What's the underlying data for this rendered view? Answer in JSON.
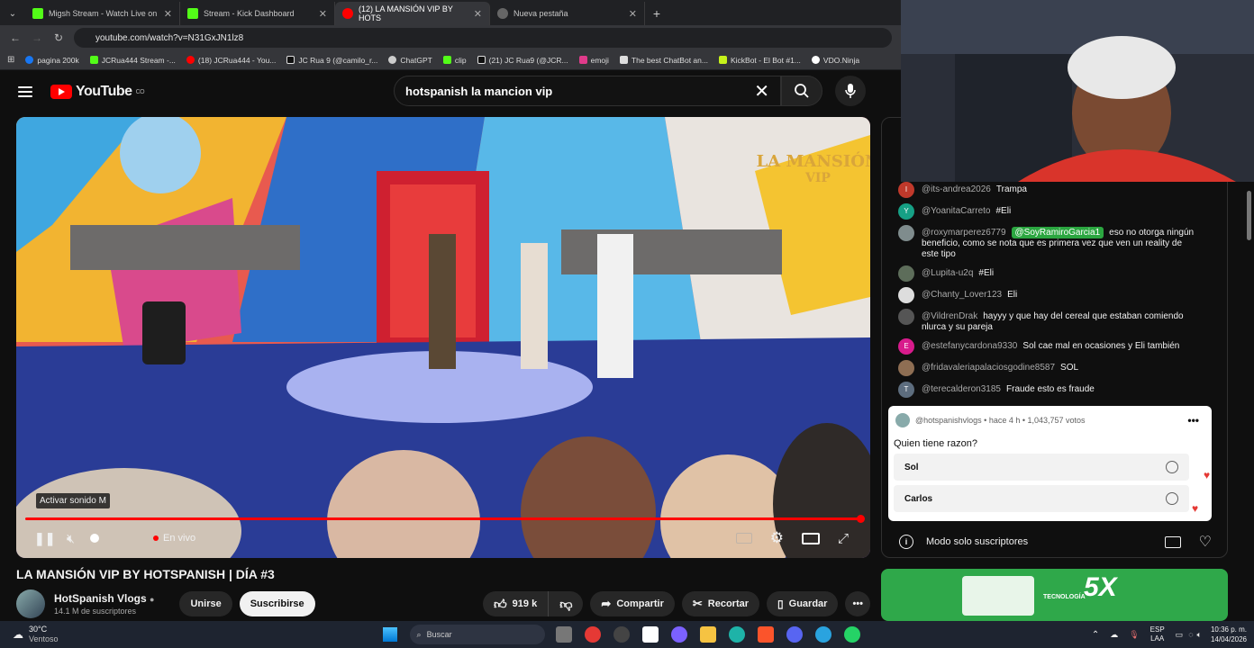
{
  "browser": {
    "tabs": [
      {
        "label": "Migsh Stream - Watch Live on",
        "color": "#53fc18"
      },
      {
        "label": "Stream - Kick Dashboard",
        "color": "#53fc18"
      },
      {
        "label": "(12) LA MANSIÓN VIP BY HOTS",
        "color": "#ff0000"
      },
      {
        "label": "Nueva pestaña",
        "color": "#888888"
      }
    ],
    "url": "youtube.com/watch?v=N31GxJN1lz8",
    "bookmarks": [
      {
        "label": "pagina 200k",
        "color": "#1877f2"
      },
      {
        "label": "JCRua444 Stream -...",
        "color": "#53fc18"
      },
      {
        "label": "(18) JCRua444 - You...",
        "color": "#ff0000"
      },
      {
        "label": "JC Rua 9 (@camilo_r...",
        "color": "#eeeeee"
      },
      {
        "label": "ChatGPT",
        "color": "#cccccc"
      },
      {
        "label": "clip",
        "color": "#53fc18"
      },
      {
        "label": "(21) JC Rua9 (@JCR...",
        "color": "#eeeeee"
      },
      {
        "label": "emoji",
        "color": "#e03b8b"
      },
      {
        "label": "The best ChatBot an...",
        "color": "#dddddd"
      },
      {
        "label": "KickBot - El Bot #1...",
        "color": "#c6f21a"
      },
      {
        "label": "VDO.Ninja",
        "color": "#ffffff"
      }
    ]
  },
  "youtube": {
    "logo": "YouTube",
    "logo_suffix": "CO",
    "search_query": "hotspanish la mancion vip",
    "player": {
      "tooltip": "Activar sonido  M",
      "live_label": "En vivo",
      "progress": 1.0
    },
    "video_title": "LA MANSIÓN VIP BY HOTSPANISH | DÍA #3",
    "channel_name": "HotSpanish Vlogs",
    "subscribers": "14.1 M de suscriptores",
    "join_label": "Unirse",
    "subscribe_label": "Suscribirse",
    "likes": "919 k",
    "share_label": "Compartir",
    "clip_label": "Recortar",
    "save_label": "Guardar"
  },
  "chat": {
    "messages": [
      {
        "user": "@its-andrea2026",
        "text": "Trampa",
        "avatar_letter": "I",
        "avatar_color": "#c0392b"
      },
      {
        "user": "@YoanitaCarreto",
        "text": "#Eli",
        "avatar_letter": "Y",
        "avatar_color": "#16a085"
      },
      {
        "user": "@roxymarperez6779",
        "mention": "@SoyRamiroGarcia1",
        "text": "eso no otorga ningún beneficio, como se nota que es primera vez que ven un reality de este tipo",
        "avatar_letter": "",
        "avatar_color": "#7f8c8d"
      },
      {
        "user": "@Lupita-u2q",
        "text": "#Eli",
        "avatar_letter": "",
        "avatar_color": "#5d6d5a"
      },
      {
        "user": "@Chanty_Lover123",
        "text": "Eli",
        "avatar_letter": "",
        "avatar_color": "#dddddd"
      },
      {
        "user": "@VildrenDrak",
        "text": "hayyy y que hay del cereal que estaban comiendo nlurca y su pareja",
        "avatar_letter": "",
        "avatar_color": "#555555"
      },
      {
        "user": "@estefanycardona9330",
        "text": "Sol cae mal en ocasiones y Eli también",
        "avatar_letter": "E",
        "avatar_color": "#d81b8c"
      },
      {
        "user": "@fridavaleriapalaciosgodine8587",
        "text": "SOL",
        "avatar_letter": "",
        "avatar_color": "#8e6e53"
      },
      {
        "user": "@terecalderon3185",
        "text": "Fraude esto es fraude",
        "avatar_letter": "T",
        "avatar_color": "#5d6d7e"
      }
    ],
    "poll": {
      "header": "@hotspanishvlogs • hace 4 h • 1,043,757 votos",
      "question": "Quien tiene razon?",
      "options": [
        "Sol",
        "Carlos"
      ]
    },
    "footer_label": "Modo solo suscriptores"
  },
  "ad": {
    "headline": "5X",
    "sub": "TECNOLOGÍA"
  },
  "taskbar": {
    "weather_temp": "30°C",
    "weather_desc": "Ventoso",
    "search_placeholder": "Buscar",
    "lang": "ESP",
    "lang2": "LAA",
    "time": "10:36 p. m.",
    "date": "14/04/2026"
  }
}
